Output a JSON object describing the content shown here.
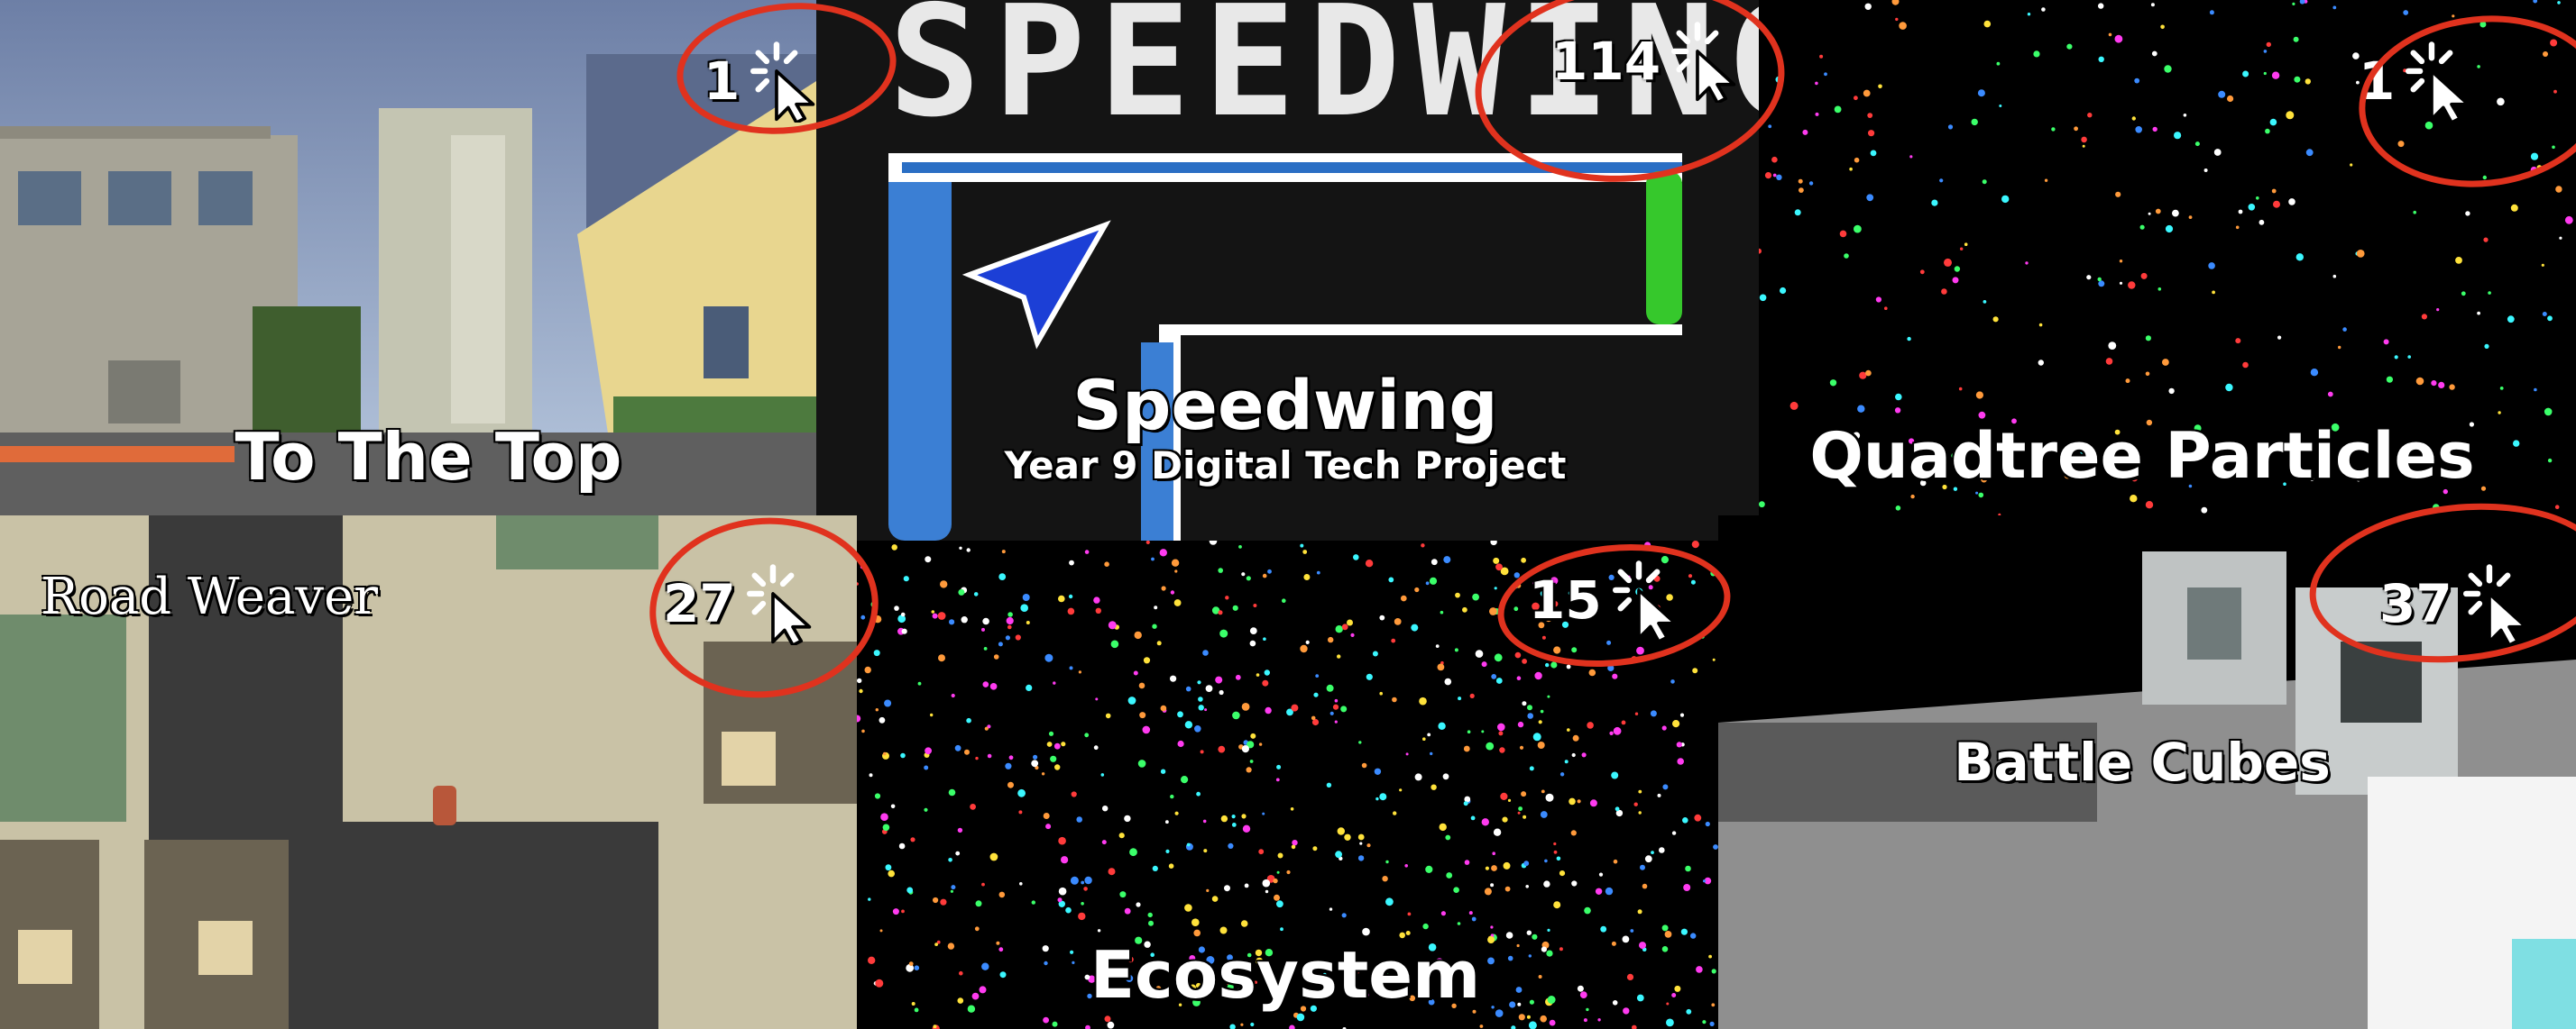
{
  "colors": {
    "accent_circle": "#e0321e"
  },
  "tiles": [
    {
      "id": "to-the-top",
      "title": "To The Top",
      "clicks": "1",
      "icon": "cursor-click-icon"
    },
    {
      "id": "speedwing",
      "header_text": "SPEEDWING",
      "title": "Speedwing",
      "subtitle": "Year 9 Digital Tech Project",
      "clicks": "114",
      "icon": "cursor-click-icon"
    },
    {
      "id": "quadtree",
      "title": "Quadtree Particles",
      "clicks": "1",
      "icon": "cursor-click-icon"
    },
    {
      "id": "road-weaver",
      "title": "Road Weaver",
      "clicks": "27",
      "icon": "cursor-click-icon"
    },
    {
      "id": "ecosystem",
      "title": "Ecosystem",
      "clicks": "15",
      "icon": "cursor-click-icon"
    },
    {
      "id": "battle-cubes",
      "title": "Battle Cubes",
      "clicks": "37",
      "icon": "cursor-click-icon"
    }
  ]
}
